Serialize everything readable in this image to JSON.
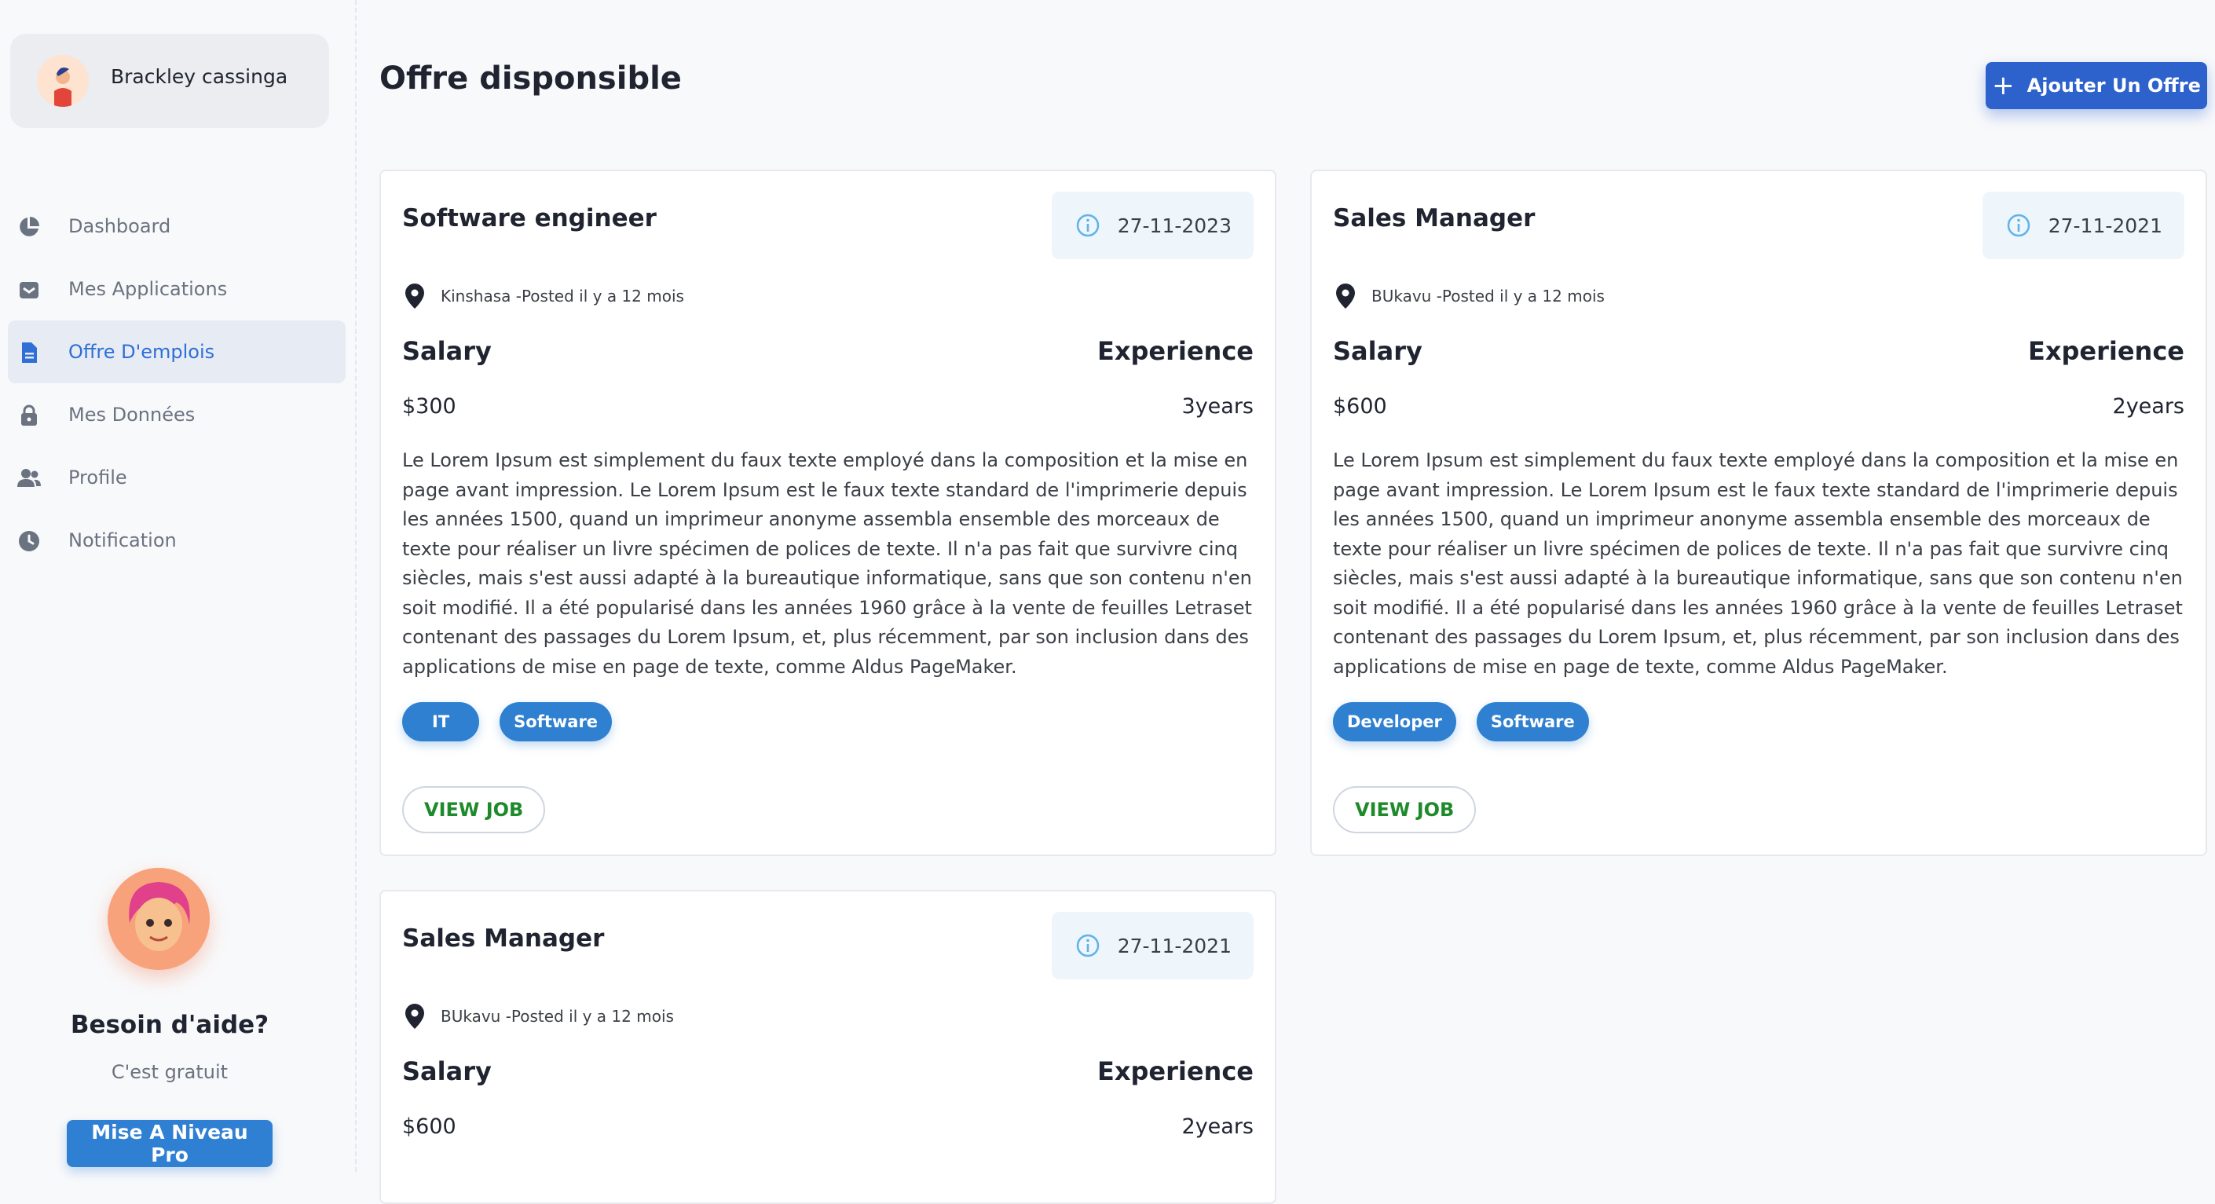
{
  "user": {
    "name": "Brackley cassinga"
  },
  "nav": [
    {
      "label": "Dashboard",
      "icon": "chart-pie-icon",
      "active": false
    },
    {
      "label": "Mes Applications",
      "icon": "inbox-icon",
      "active": false
    },
    {
      "label": "Offre D'emplois",
      "icon": "document-icon",
      "active": true
    },
    {
      "label": "Mes Données",
      "icon": "lock-icon",
      "active": false
    },
    {
      "label": "Profile",
      "icon": "users-icon",
      "active": false
    },
    {
      "label": "Notification",
      "icon": "clock-icon",
      "active": false
    }
  ],
  "help": {
    "title": "Besoin d'aide?",
    "subtitle": "C'est gratuit",
    "button": "Mise A Niveau Pro"
  },
  "header": {
    "title": "Offre disponsible",
    "add_button": "Ajouter Un Offre"
  },
  "labels": {
    "salary": "Salary",
    "experience": "Experience",
    "view_job": "VIEW JOB"
  },
  "jobs": [
    {
      "title": "Software engineer",
      "date": "27-11-2023",
      "location": "Kinshasa -Posted il y a 12 mois",
      "salary": "$300",
      "experience": "3years",
      "description": "Le Lorem Ipsum est simplement du faux texte employé dans la composition et la mise en page avant impression. Le Lorem Ipsum est le faux texte standard de l'imprimerie depuis les années 1500, quand un imprimeur anonyme assembla ensemble des morceaux de texte pour réaliser un livre spécimen de polices de texte. Il n'a pas fait que survivre cinq siècles, mais s'est aussi adapté à la bureautique informatique, sans que son contenu n'en soit modifié. Il a été popularisé dans les années 1960 grâce à la vente de feuilles Letraset contenant des passages du Lorem Ipsum, et, plus récemment, par son inclusion dans des applications de mise en page de texte, comme Aldus PageMaker.",
      "tags": [
        "IT",
        "Software"
      ]
    },
    {
      "title": "Sales Manager",
      "date": "27-11-2021",
      "location": "BUkavu -Posted il y a 12 mois",
      "salary": "$600",
      "experience": "2years",
      "description": "Le Lorem Ipsum est simplement du faux texte employé dans la composition et la mise en page avant impression. Le Lorem Ipsum est le faux texte standard de l'imprimerie depuis les années 1500, quand un imprimeur anonyme assembla ensemble des morceaux de texte pour réaliser un livre spécimen de polices de texte. Il n'a pas fait que survivre cinq siècles, mais s'est aussi adapté à la bureautique informatique, sans que son contenu n'en soit modifié. Il a été popularisé dans les années 1960 grâce à la vente de feuilles Letraset contenant des passages du Lorem Ipsum, et, plus récemment, par son inclusion dans des applications de mise en page de texte, comme Aldus PageMaker.",
      "tags": [
        "Developer",
        "Software"
      ]
    },
    {
      "title": "Sales Manager",
      "date": "27-11-2021",
      "location": "BUkavu -Posted il y a 12 mois",
      "salary": "$600",
      "experience": "2years"
    }
  ],
  "colors": {
    "primary": "#2d62cd",
    "tag": "#2f80d0",
    "view_job_text": "#1e8a2b",
    "active_nav": "#2f6fd6"
  }
}
